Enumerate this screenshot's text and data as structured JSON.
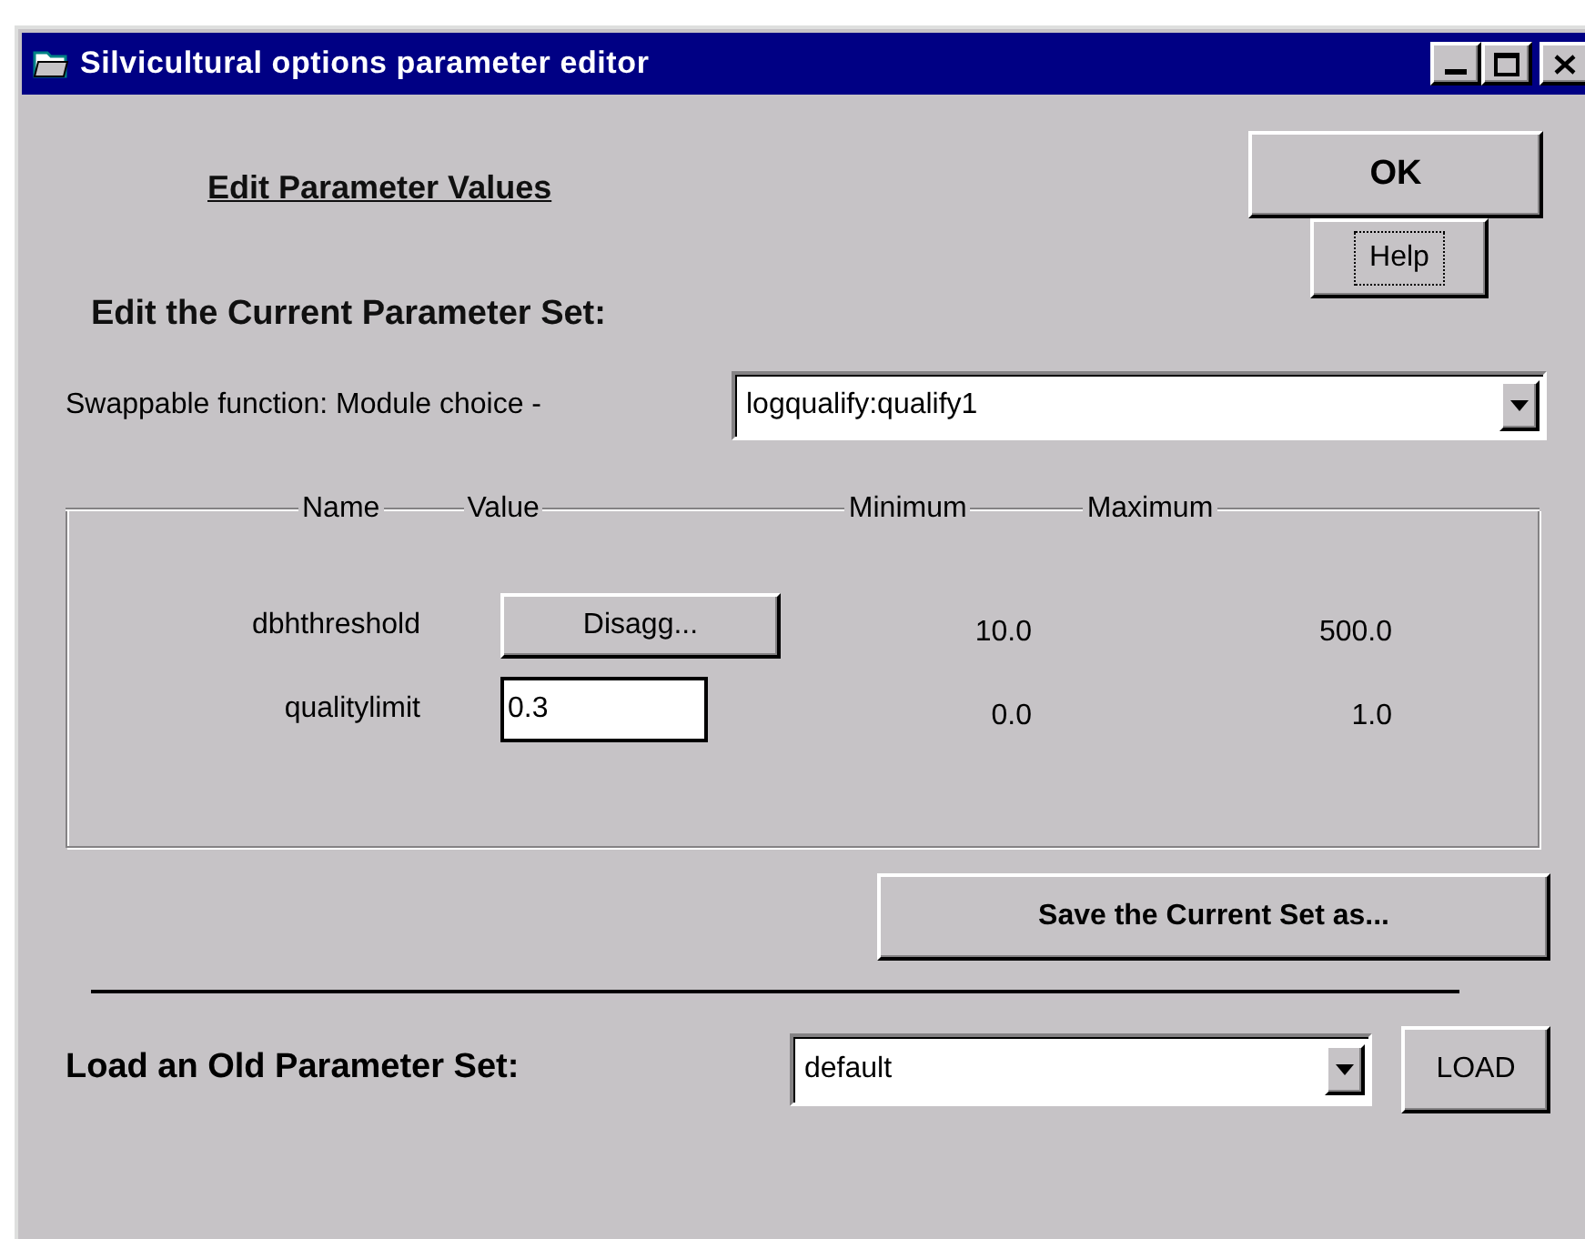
{
  "window": {
    "title": "Silvicultural options parameter editor"
  },
  "heading": "Edit Parameter Values",
  "ok_button": {
    "label": "OK"
  },
  "help_button": {
    "label": "Help",
    "focused": true
  },
  "section_title": "Edit the Current Parameter Set:",
  "module_choice": {
    "label": "Swappable function: Module choice -",
    "value": "logqualify:qualify1"
  },
  "parameters": {
    "columns": [
      "Name",
      "Value",
      "Minimum",
      "Maximum"
    ],
    "rows": [
      {
        "name": "dbhthreshold",
        "kind": "button",
        "value": "Disagg...",
        "minimum": "10.0",
        "maximum": "500.0"
      },
      {
        "name": "qualitylimit",
        "kind": "input",
        "value": "0.3",
        "minimum": "0.0",
        "maximum": "1.0"
      }
    ]
  },
  "save_button": {
    "label": "Save the Current Set as..."
  },
  "load": {
    "label": "Load an Old Parameter Set:",
    "value": "default",
    "button": "LOAD"
  }
}
